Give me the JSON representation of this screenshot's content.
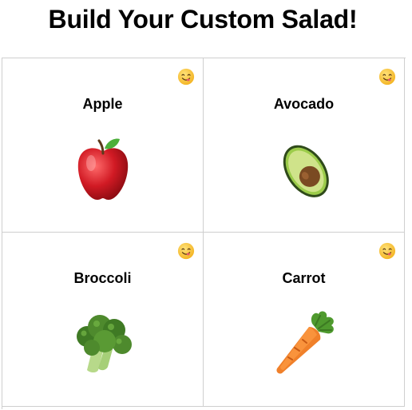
{
  "header": {
    "title": "Build Your Custom Salad!"
  },
  "ingredients": [
    {
      "name": "Apple",
      "icon": "apple-icon"
    },
    {
      "name": "Avocado",
      "icon": "avocado-icon"
    },
    {
      "name": "Broccoli",
      "icon": "broccoli-icon"
    },
    {
      "name": "Carrot",
      "icon": "carrot-icon"
    }
  ],
  "reaction_icon": "yum-face-icon",
  "colors": {
    "grid_border": "#cfcfcf",
    "smiley_yellow": "#f8c534",
    "apple_red": "#c5161d",
    "avocado_green": "#8fbf3a",
    "broccoli_green": "#4e8a2d",
    "carrot_orange": "#f0802a"
  }
}
